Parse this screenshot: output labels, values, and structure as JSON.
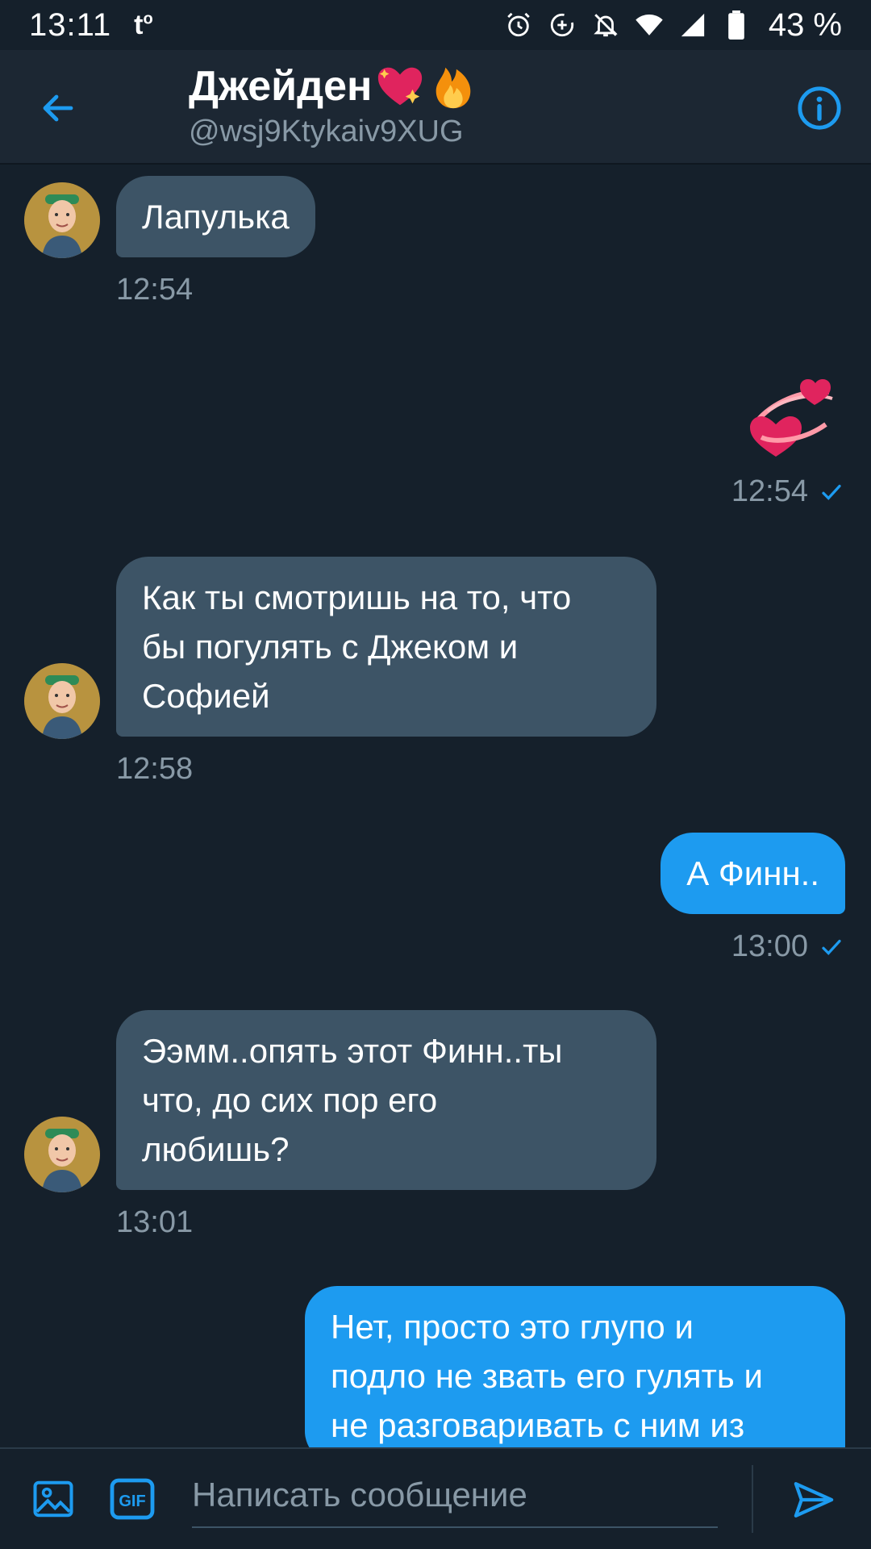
{
  "status_bar": {
    "time": "13:11",
    "left_glyph": "t",
    "battery": "43 %",
    "icons": [
      "alarm-icon",
      "data-saver-icon",
      "notifications-off-icon",
      "wifi-icon",
      "signal-icon",
      "battery-icon"
    ]
  },
  "header": {
    "name": "Джейден",
    "handle": "@wsj9Ktykaiv9XUG",
    "accent": "#1d9bf0"
  },
  "messages": [
    {
      "side": "in",
      "text": "Лапулька",
      "time": "12:54"
    },
    {
      "side": "out",
      "kind": "emoji",
      "emoji_name": "two-hearts-icon",
      "time": "12:54"
    },
    {
      "side": "in",
      "text_lines": [
        "Как ты смотришь на то, что",
        "бы погулять  с Джеком и",
        "Софией"
      ],
      "time": "12:58"
    },
    {
      "side": "out",
      "text": "А Финн..",
      "time": "13:00"
    },
    {
      "side": "in",
      "text_lines": [
        "Ээмм..опять этот Финн..ты",
        "что, до сих пор его",
        "любишь?"
      ],
      "time": "13:01"
    },
    {
      "side": "out",
      "text_lines": [
        "Нет, просто это глупо и",
        "подло не звать его гулять и",
        "не разговаривать с ним из"
      ]
    }
  ],
  "compose": {
    "placeholder": "Написать сообщение",
    "icons": [
      "image-icon",
      "gif-icon",
      "send-icon"
    ]
  },
  "colors": {
    "background": "#15202b",
    "header": "#1c2733",
    "incoming_bubble": "#3d5466",
    "outgoing_bubble": "#1d9bf0",
    "muted_text": "#8899a6"
  }
}
